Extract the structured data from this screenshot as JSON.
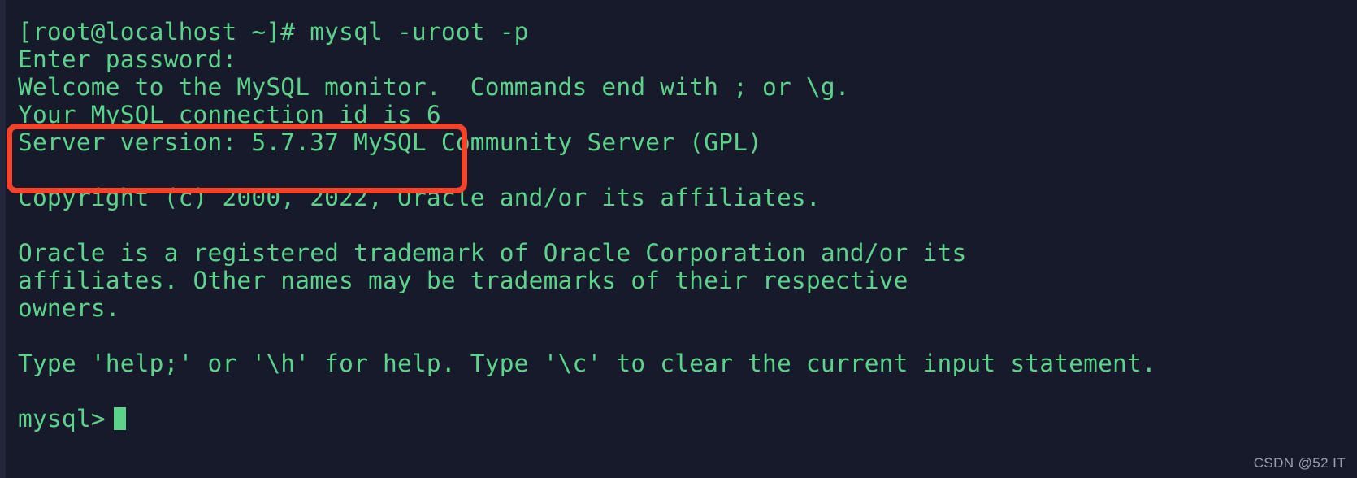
{
  "terminal": {
    "background_color": "#171a2b",
    "text_color": "#5cd38a",
    "cursor_color": "#5cd38a",
    "lines": [
      {
        "id": "prompt-command",
        "text": "[root@localhost ~]# mysql -uroot -p"
      },
      {
        "id": "enter-password",
        "text": "Enter password:"
      },
      {
        "id": "welcome",
        "text": "Welcome to the MySQL monitor.  Commands end with ; or \\g."
      },
      {
        "id": "connection-id",
        "text": "Your MySQL connection id is 6"
      },
      {
        "id": "server-version",
        "text": "Server version: 5.7.37 MySQL Community Server (GPL)"
      },
      {
        "id": "blank-1",
        "text": " "
      },
      {
        "id": "copyright",
        "text": "Copyright (c) 2000, 2022, Oracle and/or its affiliates."
      },
      {
        "id": "blank-2",
        "text": " "
      },
      {
        "id": "trademark-1",
        "text": "Oracle is a registered trademark of Oracle Corporation and/or its"
      },
      {
        "id": "trademark-2",
        "text": "affiliates. Other names may be trademarks of their respective"
      },
      {
        "id": "trademark-3",
        "text": "owners."
      },
      {
        "id": "blank-3",
        "text": " "
      },
      {
        "id": "help-hint",
        "text": "Type 'help;' or '\\h' for help. Type '\\c' to clear the current input statement."
      },
      {
        "id": "blank-4",
        "text": " "
      }
    ],
    "prompt": {
      "text": "mysql>",
      "cursor": "block"
    }
  },
  "annotation": {
    "shape": "rounded-rectangle",
    "color": "#f4432a",
    "stroke_width_px": 7,
    "highlights": "Server version: 5.7.37 MySQL Community Server (GPL)"
  },
  "watermark": {
    "text": "CSDN @52 IT",
    "color": "#9aa0ae"
  }
}
